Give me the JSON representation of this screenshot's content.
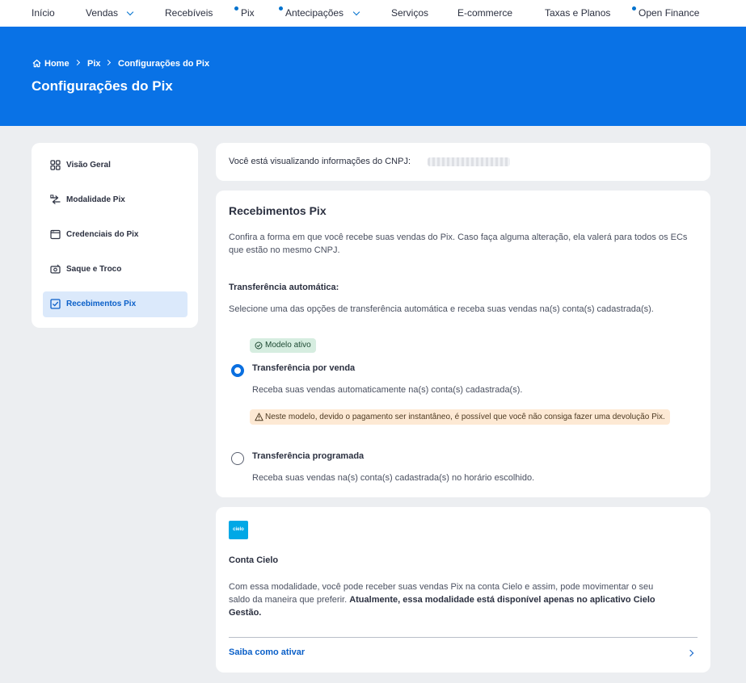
{
  "nav": {
    "items": [
      {
        "label": "Início"
      },
      {
        "label": "Vendas"
      },
      {
        "label": "Recebíveis"
      },
      {
        "label": "Pix"
      },
      {
        "label": "Antecipações"
      },
      {
        "label": "Serviços"
      },
      {
        "label": "E-commerce"
      },
      {
        "label": "Taxas e Planos"
      },
      {
        "label": "Open Finance"
      }
    ]
  },
  "breadcrumb": [
    "Home",
    "Pix",
    "Configurações do Pix"
  ],
  "page_title": "Configurações do Pix",
  "sidebar": {
    "items": [
      {
        "label": "Visão Geral",
        "icon": "grid-icon"
      },
      {
        "label": "Modalidade Pix",
        "icon": "swap-icon"
      },
      {
        "label": "Credenciais do Pix",
        "icon": "window-icon"
      },
      {
        "label": "Saque e Troco",
        "icon": "cash-icon"
      },
      {
        "label": "Recebimentos Pix",
        "icon": "checkbox-icon",
        "active": true
      }
    ]
  },
  "cnpj": {
    "text": "Você está visualizando informações do CNPJ:"
  },
  "recebimentos": {
    "title": "Recebimentos Pix",
    "description": "Confira a forma em que você recebe suas vendas do Pix. Caso faça alguma alteração, ela valerá para todos os ECs que estão no mesmo CNPJ.",
    "subtitle": "Transferência automática:",
    "subdescription": "Selecione uma das opções de transferência automática e receba suas vendas na(s) conta(s) cadastrada(s).",
    "active_badge": "Modelo ativo",
    "options": [
      {
        "title": "Transferência por venda",
        "description": "Receba suas vendas automaticamente na(s) conta(s) cadastrada(s).",
        "selected": true,
        "warning": "Neste modelo, devido o pagamento ser instantâneo, é possível que você não consiga fazer uma devolução Pix."
      },
      {
        "title": "Transferência programada",
        "description": "Receba suas vendas na(s) conta(s) cadastrada(s) no horário escolhido.",
        "selected": false
      }
    ]
  },
  "conta_cielo": {
    "logo_text": "cielo",
    "title": "Conta Cielo",
    "description_plain": "Com essa modalidade, você pode receber suas vendas Pix na conta Cielo e assim, pode movimentar o seu saldo da maneira que preferir. ",
    "description_bold": "Atualmente, essa modalidade está disponível apenas no aplicativo Cielo Gestão.",
    "link": "Saiba como ativar"
  },
  "colors": {
    "brand_blue": "#0972e6",
    "link_blue": "#0a5fc8",
    "active_badge_bg": "#d6ede0",
    "warning_bg": "#fde9d4",
    "background": "#eceef1"
  }
}
